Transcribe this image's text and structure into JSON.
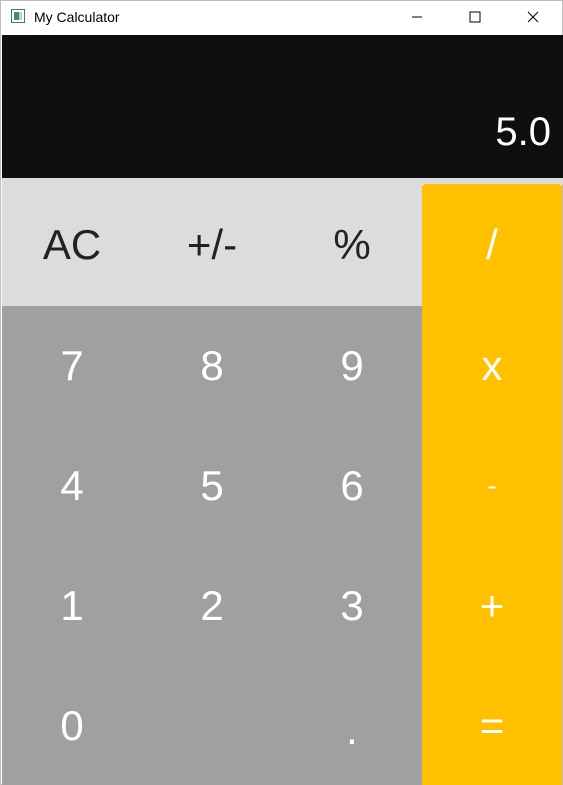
{
  "window": {
    "title": "My Calculator",
    "controls": {
      "minimize_icon": "minimize-icon",
      "maximize_icon": "maximize-icon",
      "close_icon": "close-icon"
    }
  },
  "display": {
    "value": "5.0",
    "background": "#0f0f0f",
    "text_color": "#ffffff"
  },
  "keypad": {
    "colors": {
      "function_key": "#dcdcdc",
      "number_key": "#a0a0a0",
      "operator_key": "#ffc000"
    },
    "rows": [
      [
        {
          "label": "AC"
        },
        {
          "label": "+/-"
        },
        {
          "label": "%"
        },
        {
          "label": "/"
        }
      ],
      [
        {
          "label": "7"
        },
        {
          "label": "8"
        },
        {
          "label": "9"
        },
        {
          "label": "x"
        }
      ],
      [
        {
          "label": "4"
        },
        {
          "label": "5"
        },
        {
          "label": "6"
        },
        {
          "label": "-"
        }
      ],
      [
        {
          "label": "1"
        },
        {
          "label": "2"
        },
        {
          "label": "3"
        },
        {
          "label": "+"
        }
      ],
      [
        {
          "label": "0"
        },
        {
          "label": ""
        },
        {
          "label": "."
        },
        {
          "label": "="
        }
      ]
    ]
  }
}
